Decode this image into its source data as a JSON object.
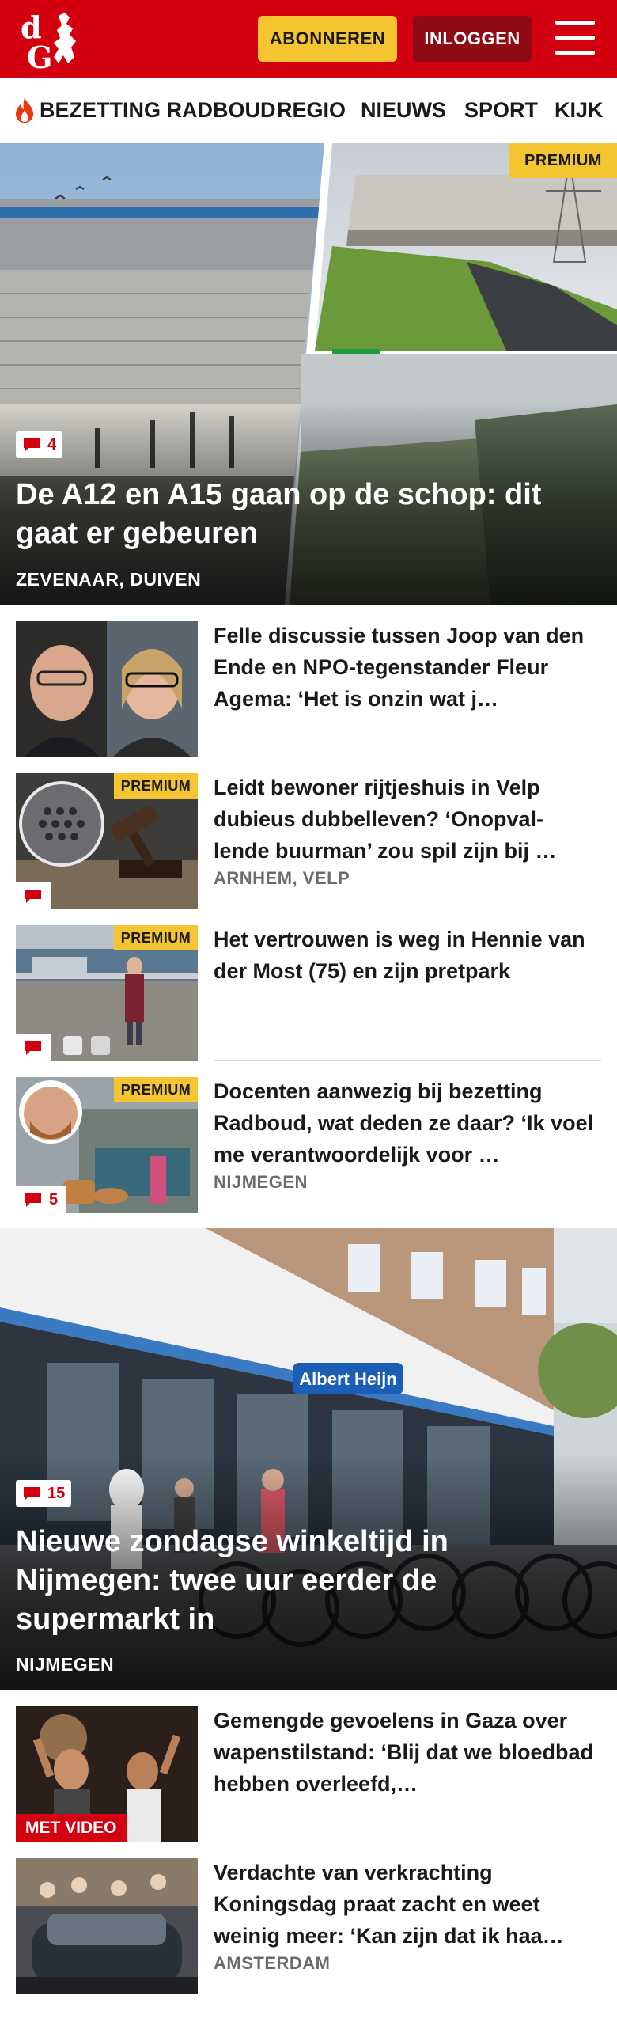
{
  "header": {
    "logo_text": "dG",
    "subscribe_label": "ABONNEREN",
    "login_label": "INLOGGEN"
  },
  "nav": {
    "items": [
      "BEZETTING RADBOUD",
      "REGIO",
      "NIEUWS",
      "SPORT",
      "KIJK"
    ]
  },
  "colors": {
    "brand_red": "#d3000f",
    "premium_yellow": "#f4c531",
    "login_dark_red": "#8f0a12"
  },
  "hero1": {
    "comments": "4",
    "premium_label": "PREMIUM",
    "title": "De A12 en A15 gaan op de schop: dit gaat er gebeuren",
    "location": "ZEVENAAR, DUIVEN"
  },
  "articles": [
    {
      "title": "Felle discussie tussen Joop van den Ende en NPO-tegenstander Fleur Agema: ‘Het is onzin wat j…"
    },
    {
      "premium_label": "PREMIUM",
      "title": "Leidt bewoner rijtjeshuis in Velp dubieus dubbelleven? ‘Onopval-lende buurman’ zou spil zijn bij …",
      "location": "ARNHEM, VELP"
    },
    {
      "premium_label": "PREMIUM",
      "title": "Het vertrouwen is weg in Hennie van der Most (75) en zijn pretpark"
    },
    {
      "premium_label": "PREMIUM",
      "comments": "5",
      "title": "Docenten aanwezig bij bezetting Radboud, wat deden ze daar? ‘Ik voel me verantwoordelijk voor …",
      "location": "NIJMEGEN"
    }
  ],
  "hero2": {
    "comments": "15",
    "title": "Nieuwe zondagse winkeltijd in Nijmegen: twee uur eerder de supermarkt in",
    "location": "NIJMEGEN",
    "store_sign": "Albert Heijn"
  },
  "articles2": [
    {
      "video_label": "MET VIDEO",
      "title": "Gemengde gevoelens in Gaza over wapenstilstand: ‘Blij dat we bloedbad hebben overleefd,…"
    },
    {
      "title": "Verdachte van verkrachting Koningsdag praat zacht en weet weinig meer: ‘Kan zijn dat ik haa…",
      "location": "AMSTERDAM"
    }
  ]
}
